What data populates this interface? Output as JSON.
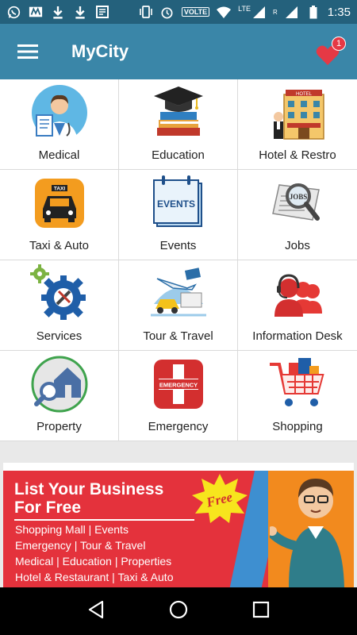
{
  "status": {
    "network": "LTE",
    "volte": "VOLTE",
    "roaming": "R",
    "time": "1:35"
  },
  "app": {
    "title": "MyCity",
    "favorites_count": "1"
  },
  "categories": [
    {
      "label": "Medical",
      "icon": "doctor-icon"
    },
    {
      "label": "Education",
      "icon": "graduation-books-icon"
    },
    {
      "label": "Hotel & Restro",
      "icon": "hotel-building-icon"
    },
    {
      "label": "Taxi & Auto",
      "icon": "taxi-icon"
    },
    {
      "label": "Events",
      "icon": "events-calendar-icon"
    },
    {
      "label": "Jobs",
      "icon": "jobs-newspaper-icon"
    },
    {
      "label": "Services",
      "icon": "gear-tools-icon"
    },
    {
      "label": "Tour & Travel",
      "icon": "travel-icon"
    },
    {
      "label": "Information Desk",
      "icon": "support-agents-icon"
    },
    {
      "label": "Property",
      "icon": "property-search-icon"
    },
    {
      "label": "Emergency",
      "icon": "emergency-cross-icon"
    },
    {
      "label": "Shopping",
      "icon": "shopping-cart-icon"
    }
  ],
  "icon_text": {
    "taxi": "TAXI",
    "events": "EVENTS",
    "jobs": "JOBS",
    "emergency": "EMERGENCY",
    "hotel": "HOTEL"
  },
  "banner": {
    "heading_line1": "List Your Business",
    "heading_line2": "For Free",
    "free_label": "Free",
    "lines": [
      "Shopping Mall  |  Events",
      "Emergency  |  Tour & Travel",
      "Medical  |  Education | Properties",
      "Hotel & Restaurant  |  Taxi & Auto"
    ]
  },
  "colors": {
    "statusbar": "#24617c",
    "appbar": "#3a86a8",
    "banner_red": "#e4323c",
    "banner_orange": "#f28a1e"
  }
}
